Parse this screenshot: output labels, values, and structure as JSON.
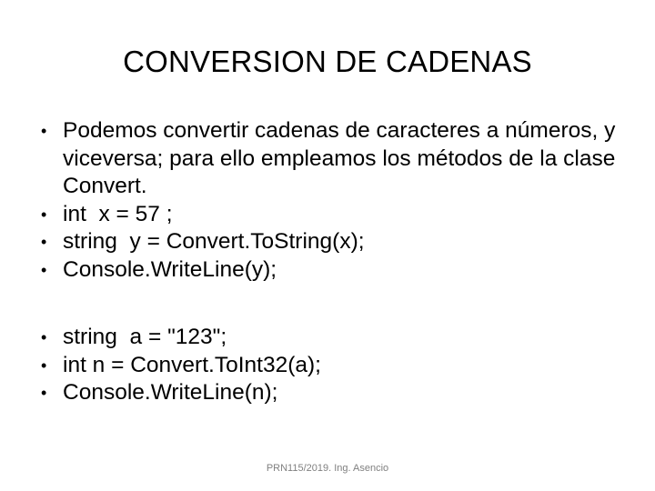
{
  "slide": {
    "title": "CONVERSION DE CADENAS",
    "background_color": "#FFFFFF",
    "text_color": "#000000",
    "footer_color": "#808080",
    "groups": [
      {
        "bullets": [
          {
            "text": "Podemos convertir cadenas de caracteres a números, y viceversa; para ello empleamos los métodos de la clase Convert.",
            "style": "paragraph"
          },
          {
            "text": "int  x = 57 ;",
            "style": "code"
          },
          {
            "text": "string  y = Convert.ToString(x);",
            "style": "code"
          },
          {
            "text": "Console.WriteLine(y);",
            "style": "code"
          }
        ]
      },
      {
        "bullets": [
          {
            "text": "string  a = \"123\";",
            "style": "code"
          },
          {
            "text": "int n = Convert.ToInt32(a);",
            "style": "code"
          },
          {
            "text": "Console.WriteLine(n);",
            "style": "code"
          }
        ]
      }
    ],
    "footer": "PRN115/2019. Ing. Asencio"
  }
}
